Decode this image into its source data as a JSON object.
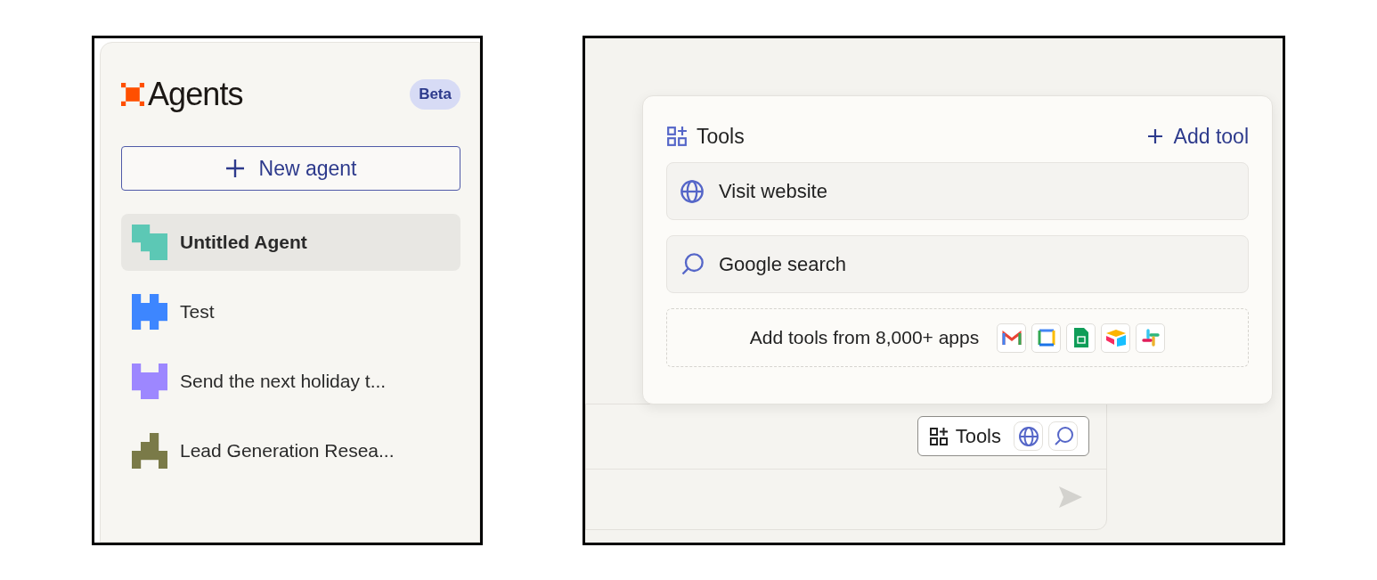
{
  "sidebar": {
    "logo": "Agents",
    "badge": "Beta",
    "new_button": "New agent",
    "agents": [
      {
        "name": "Untitled Agent",
        "selected": true,
        "color": "#5cc8b5"
      },
      {
        "name": "Test",
        "selected": false,
        "color": "#3d86ff"
      },
      {
        "name": "Send the next holiday t...",
        "selected": false,
        "color": "#9d87ff"
      },
      {
        "name": "Lead Generation Resea...",
        "selected": false,
        "color": "#7a7a48"
      }
    ]
  },
  "tools_popup": {
    "title": "Tools",
    "add_button": "Add tool",
    "tools": [
      {
        "kind": "globe",
        "label": "Visit website"
      },
      {
        "kind": "search",
        "label": "Google search"
      }
    ],
    "apps_text": "Add tools from 8,000+ apps"
  },
  "composer": {
    "tools_button": "Tools",
    "enabled_tools": [
      {
        "kind": "globe"
      },
      {
        "kind": "search"
      }
    ]
  }
}
